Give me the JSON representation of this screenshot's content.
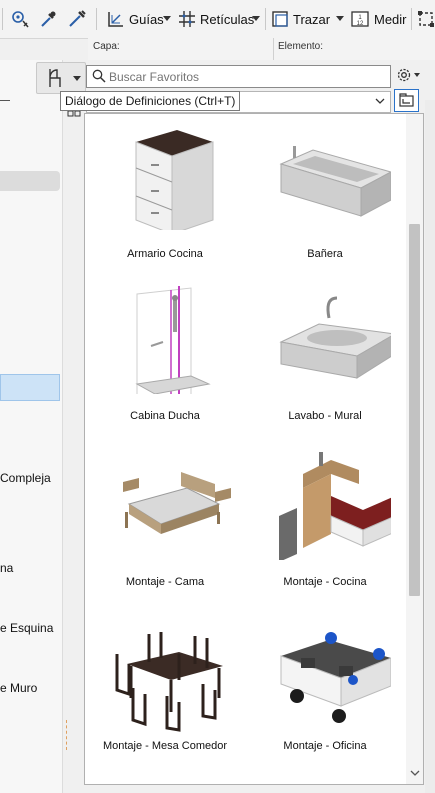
{
  "toolbar": {
    "guides_label": "Guías",
    "grids_label": "Retículas",
    "trace_label": "Trazar",
    "measure_label": "Medir"
  },
  "info": {
    "layer_label": "Capa:",
    "element_label": "Elemento:"
  },
  "left_panel": {
    "items": [
      "Compleja",
      "na",
      "e Esquina",
      "e Muro"
    ]
  },
  "search": {
    "placeholder": "Buscar Favoritos"
  },
  "tooltip": {
    "text": "Diálogo de Definiciones (Ctrl+T)"
  },
  "favorites": {
    "items": [
      {
        "label": "Armario Cocina",
        "icon": "kitchen-cabinet-icon"
      },
      {
        "label": "Bañera",
        "icon": "bathtub-icon"
      },
      {
        "label": "Cabina Ducha",
        "icon": "shower-cabin-icon"
      },
      {
        "label": "Lavabo - Mural",
        "icon": "wall-sink-icon"
      },
      {
        "label": "Montaje - Cama",
        "icon": "bed-set-icon"
      },
      {
        "label": "Montaje - Cocina",
        "icon": "kitchen-set-icon"
      },
      {
        "label": "Montaje - Mesa Comedor",
        "icon": "dining-table-set-icon"
      },
      {
        "label": "Montaje - Oficina",
        "icon": "office-set-icon"
      }
    ]
  },
  "colors": {
    "accent": "#2a72c9",
    "selection": "#cde3f7"
  }
}
